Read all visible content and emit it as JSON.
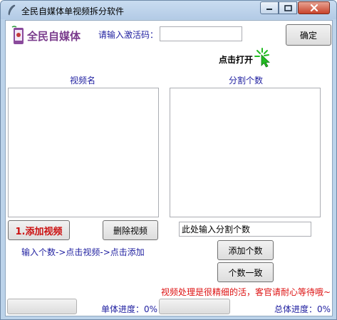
{
  "window": {
    "title": "全民自媒体单视频拆分软件"
  },
  "header": {
    "brand": "全民自媒体",
    "activation_label": "请输入激活码：",
    "activation_value": "",
    "confirm_label": "确定",
    "click_open": "点击打开"
  },
  "columns": {
    "video_name": "视频名",
    "split_count": "分割个数"
  },
  "actions": {
    "add_video": "1.添加视频",
    "delete_video": "删除视频",
    "split_input_value": "此处输入分割个数",
    "hint": "输入个数->点击视频->点击添加",
    "add_count": "添加个数",
    "equal_count": "个数一致",
    "warning": "视频处理是很精细的活，客官请耐心等待哦~"
  },
  "progress": {
    "single_label": "单体进度：0%",
    "single_value": 0,
    "total_label": "总体进度：0%",
    "total_value": 0
  },
  "icons": {
    "title": "feather-icon",
    "logo": "phone-logo-icon",
    "cursor": "click-cursor-icon"
  },
  "colors": {
    "label_blue": "#1f1fa0",
    "warning_red": "#dd1111",
    "brand_purple": "#7a3b8c",
    "cursor_green": "#22bb22"
  }
}
